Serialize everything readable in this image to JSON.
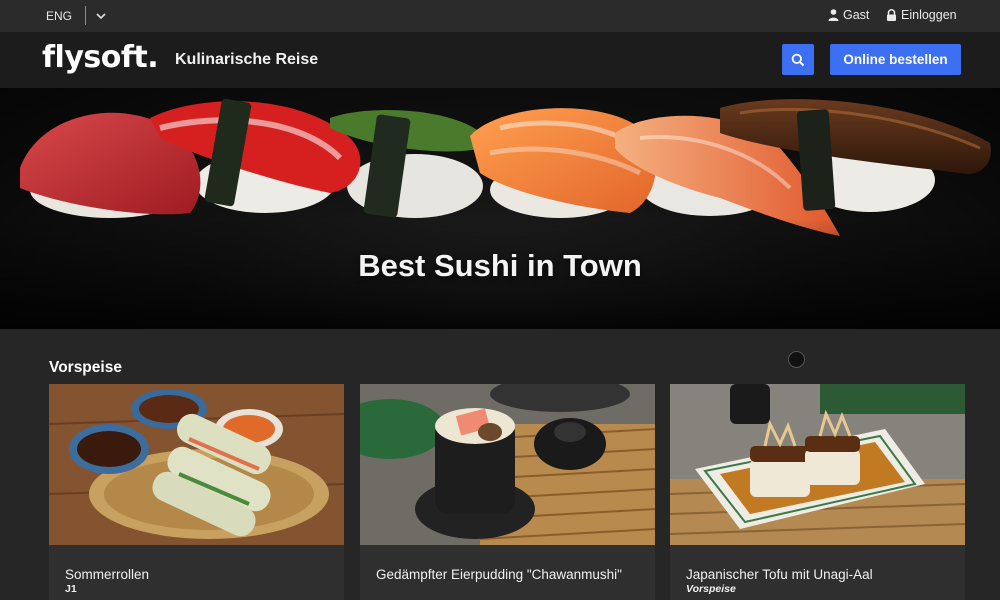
{
  "topbar": {
    "language": "ENG",
    "guest_label": "Gast",
    "login_label": "Einloggen"
  },
  "header": {
    "logo": "flysoft.",
    "tagline": "Kulinarische Reise",
    "order_button": "Online bestellen"
  },
  "hero": {
    "title": "Best Sushi in Town"
  },
  "section": {
    "title": "Vorspeise"
  },
  "cards": [
    {
      "name": "Sommerrollen",
      "sub": "J1"
    },
    {
      "name": "Gedämpfter Eierpudding \"Chawanmushi\"",
      "sub": ""
    },
    {
      "name": "Japanischer Tofu mit Unagi-Aal",
      "sub": "Vorspeise"
    }
  ],
  "colors": {
    "accent": "#3d6ff2",
    "header_bg": "#1c1c1c",
    "topbar_bg": "#2b2b2b",
    "page_bg": "#262626",
    "card_bg": "#2f2f2f"
  }
}
